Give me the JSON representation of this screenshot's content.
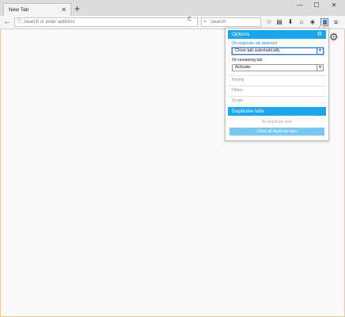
{
  "browser": {
    "tab_title": "New Tab",
    "tab_close": "✕",
    "new_tab": "+",
    "window_controls": [
      "—",
      "☐",
      "✕"
    ],
    "back_glyph": "←",
    "url_placeholder": "Search or enter address",
    "reload_glyph": "C",
    "search_placeholder": "Search",
    "toolbar_icons": [
      {
        "name": "bookmark-star-icon",
        "glyph": "☆"
      },
      {
        "name": "library-icon",
        "glyph": "▤"
      },
      {
        "name": "download-icon",
        "glyph": "⬇"
      },
      {
        "name": "home-icon",
        "glyph": "⌂"
      },
      {
        "name": "pocket-icon",
        "glyph": "◈"
      }
    ],
    "menu_glyph": "≡",
    "gear_glyph": "⚙"
  },
  "popup": {
    "options_title": "Options",
    "on_duplicate_label": "On duplicate tab detected",
    "on_duplicate_value": "Close tab automatically",
    "on_remaining_label": "On remaining tab",
    "on_remaining_value": "Activate",
    "sections": [
      "Priority",
      "Filters",
      "Scope"
    ],
    "duplicate_title": "Duplicate tabs",
    "no_duplicates": "No duplicate tabs",
    "close_all_label": "Close all duplicate tabs"
  },
  "colors": {
    "accent": "#1aa5ec",
    "button_disabled": "#7ac8f1",
    "label_blue": "#1a8fd8"
  }
}
